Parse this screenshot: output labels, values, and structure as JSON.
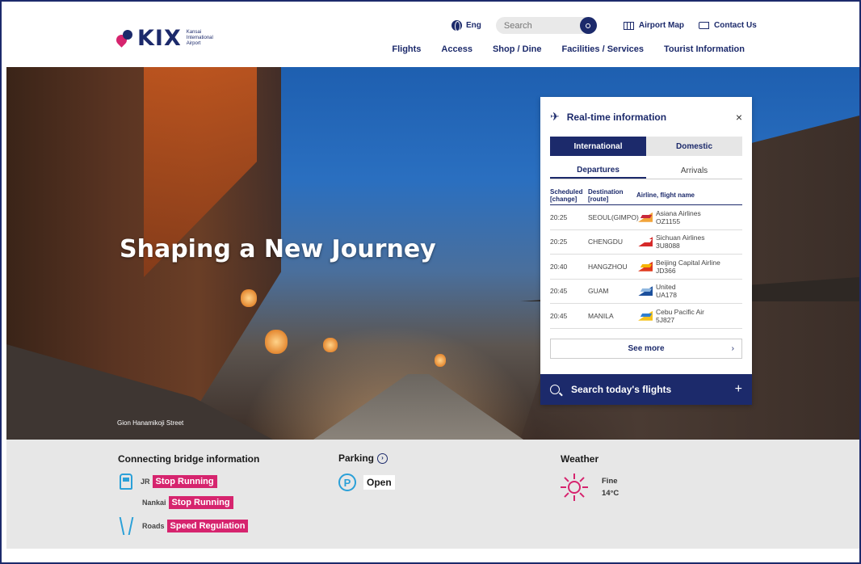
{
  "header": {
    "logo_text": "KIX",
    "logo_subtitle": "Kansai International Airport",
    "language": "Eng",
    "search_placeholder": "Search",
    "airport_map": "Airport Map",
    "contact_us": "Contact Us",
    "nav": [
      "Flights",
      "Access",
      "Shop / Dine",
      "Facilities / Services",
      "Tourist Information"
    ]
  },
  "hero": {
    "title": "Shaping a New Journey",
    "caption": "Gion Hanamikoji Street"
  },
  "realtime": {
    "title": "Real-time information",
    "close": "×",
    "tabs": [
      "International",
      "Domestic"
    ],
    "subtabs": [
      "Departures",
      "Arrivals"
    ],
    "columns": {
      "scheduled": "Scheduled [change]",
      "destination": "Destination [route]",
      "airline": "Airline, flight name"
    },
    "flights": [
      {
        "time": "20:25",
        "destination": "SEOUL(GIMPO)",
        "airline": "Asiana Airlines",
        "flight": "OZ1155",
        "color1": "#f2a43a",
        "color2": "#c8283c"
      },
      {
        "time": "20:25",
        "destination": "CHENGDU",
        "airline": "Sichuan Airlines",
        "flight": "3U8088",
        "color1": "#d62a2a",
        "color2": "#ffffff"
      },
      {
        "time": "20:40",
        "destination": "HANGZHOU",
        "airline": "Beijing Capital Airline",
        "flight": "JD366",
        "color1": "#e03a1e",
        "color2": "#f5b400"
      },
      {
        "time": "20:45",
        "destination": "GUAM",
        "airline": "United",
        "flight": "UA178",
        "color1": "#1b4f9c",
        "color2": "#8fb7e0"
      },
      {
        "time": "20:45",
        "destination": "MANILA",
        "airline": "Cebu Pacific Air",
        "flight": "5J827",
        "color1": "#f5c21b",
        "color2": "#2f7fd1"
      }
    ],
    "see_more": "See more",
    "see_more_chevron": "›",
    "search_flights": "Search today's flights",
    "search_plus": "+"
  },
  "info": {
    "bridge": {
      "title": "Connecting bridge information",
      "jr_label": "JR",
      "jr_status": "Stop Running",
      "nankai_label": "Nankai",
      "nankai_status": "Stop Running",
      "roads_label": "Roads",
      "roads_status": "Speed Regulation"
    },
    "parking": {
      "title": "Parking",
      "arrow": "›",
      "icon_letter": "P",
      "status": "Open"
    },
    "weather": {
      "title": "Weather",
      "condition": "Fine",
      "temperature": "14°C"
    }
  },
  "colors": {
    "navy": "#1c2a6b",
    "pink": "#d6246e",
    "cyan": "#2aa0d8"
  }
}
